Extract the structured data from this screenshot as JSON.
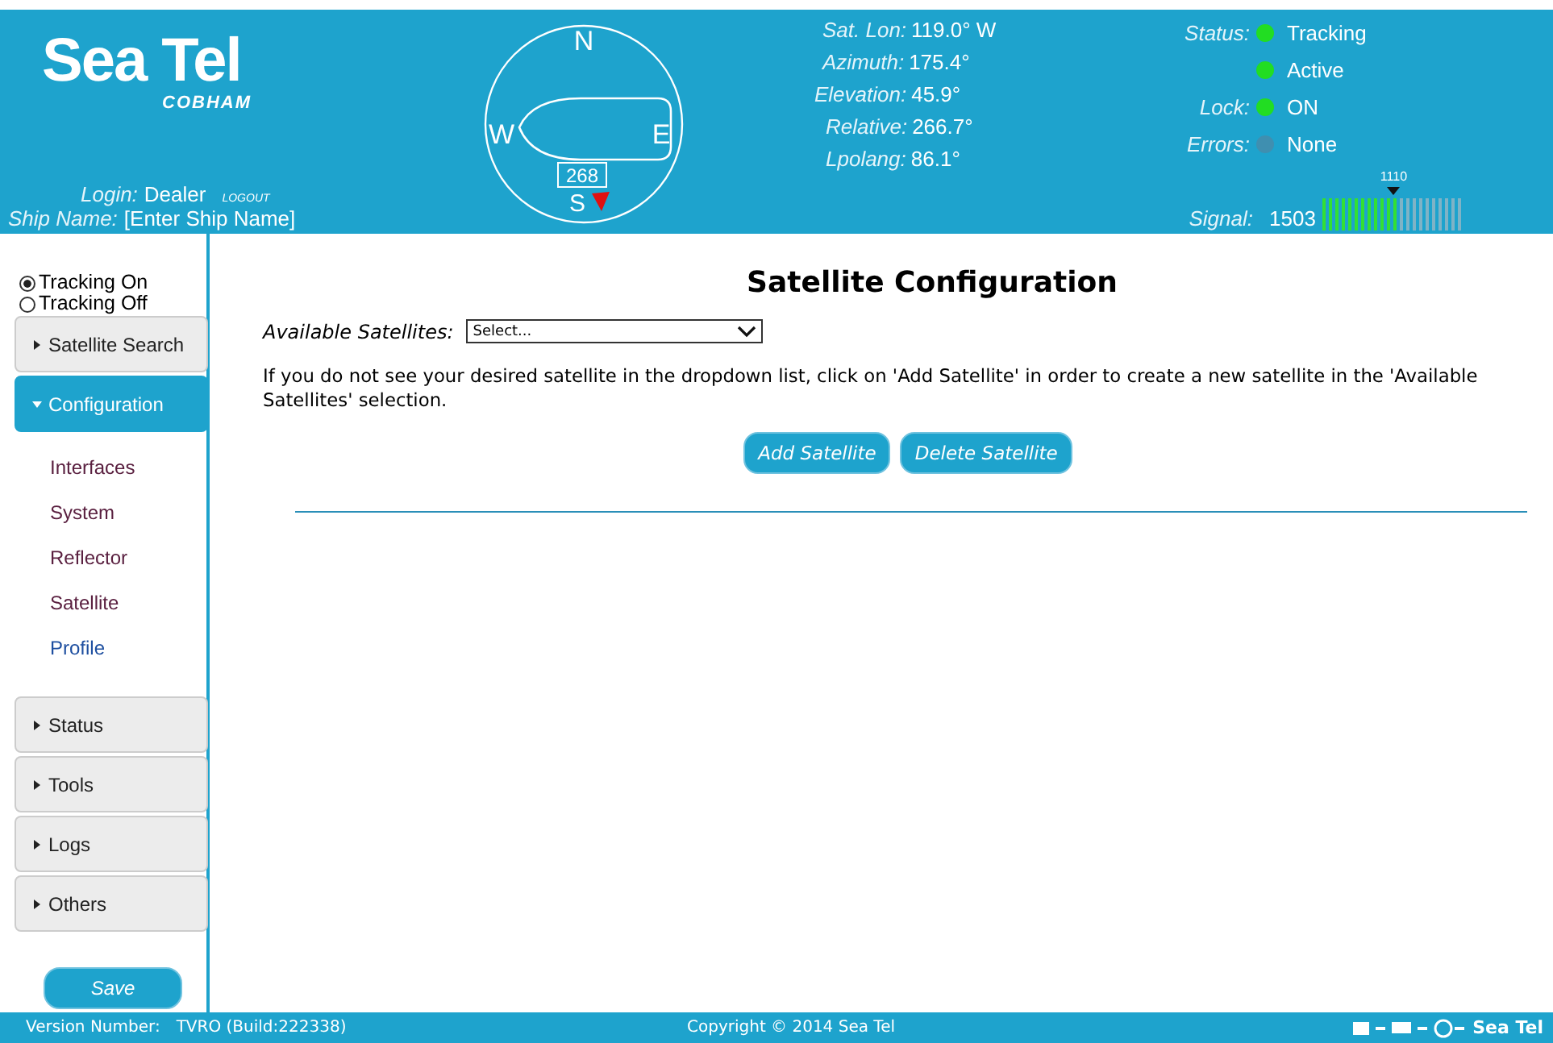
{
  "header": {
    "logo": {
      "name": "Sea Tel",
      "subtitle": "COBHAM"
    },
    "login": {
      "label": "Login:",
      "value": "Dealer",
      "logout": "LOGOUT"
    },
    "ship": {
      "label": "Ship Name:",
      "value": "[Enter Ship Name]"
    },
    "compass": {
      "north": "N",
      "west": "W",
      "east": "E",
      "south": "S",
      "heading": "268"
    },
    "readings": [
      {
        "label": "Sat. Lon:",
        "value": "119.0° W"
      },
      {
        "label": "Azimuth:",
        "value": "175.4°"
      },
      {
        "label": "Elevation:",
        "value": "45.9°"
      },
      {
        "label": "Relative:",
        "value": "266.7°"
      },
      {
        "label": "Lpolang:",
        "value": "86.1°"
      }
    ],
    "status": [
      {
        "label": "Status:",
        "value": "Tracking",
        "color": "#22dd22"
      },
      {
        "value": "Active",
        "color": "#22dd22"
      },
      {
        "label": "Lock:",
        "value": "ON",
        "color": "#22dd22"
      },
      {
        "label": "Errors:",
        "value": "None",
        "color": "#3f8fb0"
      }
    ],
    "signal": {
      "label": "Signal:",
      "value": "1503",
      "threshold": "1110",
      "level": 0.55
    }
  },
  "sidebar": {
    "tracking": [
      {
        "label": "Tracking On",
        "selected": true
      },
      {
        "label": "Tracking Off",
        "selected": false
      }
    ],
    "items": [
      {
        "kind": "header",
        "label": "Satellite Search",
        "expanded": false
      },
      {
        "kind": "header",
        "label": "Configuration",
        "expanded": true
      },
      {
        "kind": "link",
        "label": "Interfaces",
        "selected": false
      },
      {
        "kind": "link",
        "label": "System",
        "selected": false
      },
      {
        "kind": "link",
        "label": "Reflector",
        "selected": false
      },
      {
        "kind": "link",
        "label": "Satellite",
        "selected": false
      },
      {
        "kind": "link",
        "label": "Profile",
        "selected": true
      },
      {
        "kind": "header",
        "label": "Status",
        "expanded": false
      },
      {
        "kind": "header",
        "label": "Tools",
        "expanded": false
      },
      {
        "kind": "header",
        "label": "Logs",
        "expanded": false
      },
      {
        "kind": "header",
        "label": "Others",
        "expanded": false
      }
    ],
    "save": "Save"
  },
  "main": {
    "title": "Satellite Configuration",
    "select_label": "Available Satellites:",
    "select_value": "Select...",
    "help": "If you do not see your desired satellite in the dropdown list, click on 'Add Satellite' in order to create a new satellite in the 'Available Satellites' selection.",
    "buttons": [
      "Add Satellite",
      "Delete Satellite"
    ]
  },
  "footer": {
    "version_label": "Version Number:",
    "version": "TVRO (Build:222338)",
    "copyright": "Copyright © 2014 Sea Tel",
    "logo": "Sea Tel"
  }
}
